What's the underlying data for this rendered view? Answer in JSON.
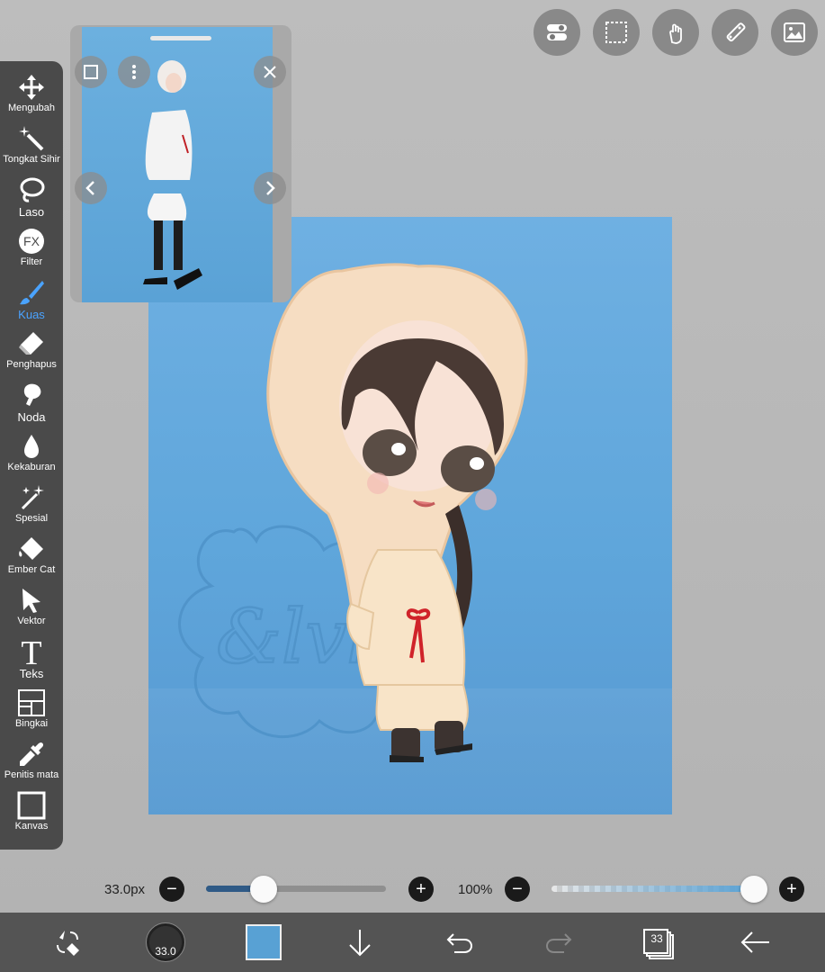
{
  "tools": [
    {
      "name": "move",
      "label": "Mengubah",
      "icon": "move-arrows-icon"
    },
    {
      "name": "magic-wand",
      "label": "Tongkat Sihir",
      "icon": "magic-wand-icon"
    },
    {
      "name": "lasso",
      "label": "Laso",
      "icon": "lasso-icon"
    },
    {
      "name": "filter",
      "label": "Filter",
      "icon": "fx-icon"
    },
    {
      "name": "brush",
      "label": "Kuas",
      "icon": "brush-icon",
      "active": true
    },
    {
      "name": "eraser",
      "label": "Penghapus",
      "icon": "eraser-icon"
    },
    {
      "name": "smudge",
      "label": "Noda",
      "icon": "smudge-icon"
    },
    {
      "name": "blur",
      "label": "Kekaburan",
      "icon": "droplet-icon"
    },
    {
      "name": "special",
      "label": "Spesial",
      "icon": "sparkle-icon"
    },
    {
      "name": "bucket",
      "label": "Ember Cat",
      "icon": "paint-bucket-icon"
    },
    {
      "name": "vector",
      "label": "Vektor",
      "icon": "cursor-arrow-icon"
    },
    {
      "name": "text",
      "label": "Teks",
      "icon": "text-t-icon"
    },
    {
      "name": "frame",
      "label": "Bingkai",
      "icon": "frame-icon"
    },
    {
      "name": "eyedropper",
      "label": "Penitis mata",
      "icon": "eyedropper-icon"
    },
    {
      "name": "canvas",
      "label": "Kanvas",
      "icon": "canvas-square-icon"
    }
  ],
  "top_tools": [
    "toggle-switch-icon",
    "selection-rect-icon",
    "touch-gesture-icon",
    "ruler-icon",
    "image-reference-icon"
  ],
  "brush": {
    "size_label": "33.0px",
    "size_fraction": 0.32,
    "opacity_label": "100%",
    "opacity_fraction": 1.0,
    "preview_value": "33.0"
  },
  "colors": {
    "current": "#58a1d4",
    "accent": "#4aa3ff"
  },
  "layers": {
    "count": "33"
  },
  "reference_window": {
    "signature_text": "&lvk"
  }
}
